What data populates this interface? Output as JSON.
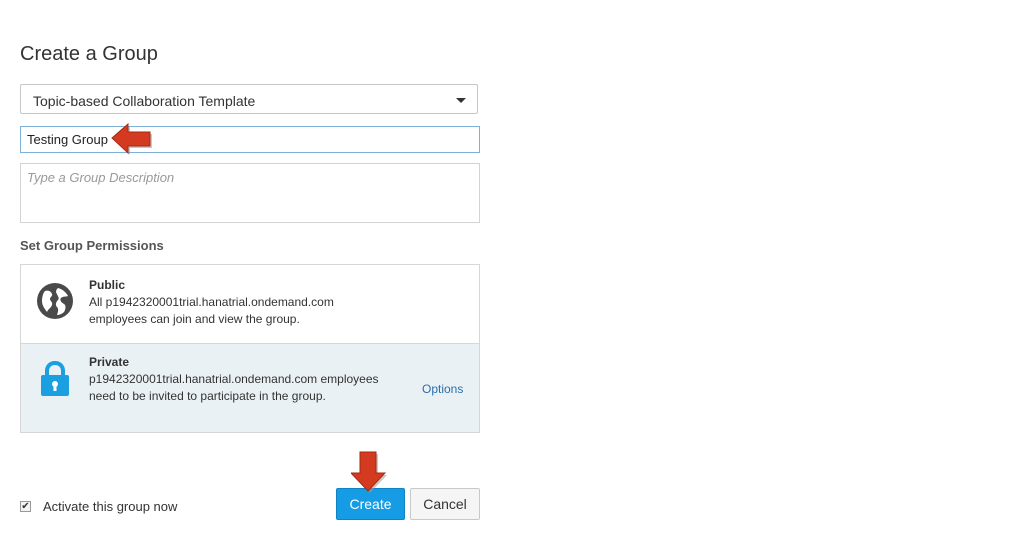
{
  "page": {
    "title": "Create a Group"
  },
  "form": {
    "template_selected": "Topic-based Collaboration Template",
    "group_name_value": "Testing Group",
    "description_placeholder": "Type a Group Description"
  },
  "permissions": {
    "heading": "Set Group Permissions",
    "public": {
      "title": "Public",
      "description": "All p1942320001trial.hanatrial.ondemand.com employees can join and view the group.",
      "icon": "globe-icon"
    },
    "private": {
      "title": "Private",
      "description": "p1942320001trial.hanatrial.ondemand.com employees need to be invited to participate in the group.",
      "options_label": "Options",
      "icon": "lock-icon",
      "selected": true
    }
  },
  "footer": {
    "activate_label": "Activate this group now",
    "activate_checked": true,
    "create_label": "Create",
    "cancel_label": "Cancel"
  },
  "colors": {
    "primary": "#159ce4",
    "link": "#2a6ea8",
    "selected_bg": "#eaf1f5",
    "annotation_arrow": "#d33a1f"
  }
}
